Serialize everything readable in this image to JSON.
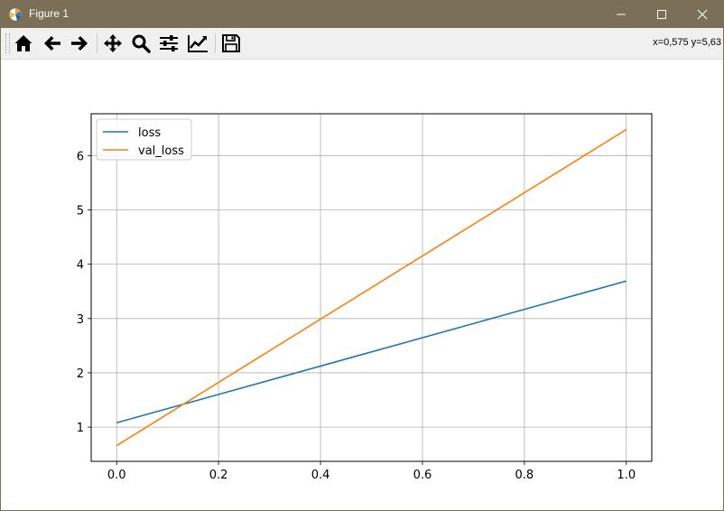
{
  "window": {
    "title": "Figure 1",
    "accent": "#7b6f57"
  },
  "toolbar": {
    "buttons": [
      {
        "name": "home-button",
        "icon": "home-icon"
      },
      {
        "name": "back-button",
        "icon": "arrow-left-icon"
      },
      {
        "name": "forward-button",
        "icon": "arrow-right-icon"
      },
      {
        "name": "pan-button",
        "icon": "move-icon"
      },
      {
        "name": "zoom-button",
        "icon": "magnifier-icon"
      },
      {
        "name": "subplots-button",
        "icon": "sliders-icon"
      },
      {
        "name": "edit-axes-button",
        "icon": "line-chart-icon"
      },
      {
        "name": "save-button",
        "icon": "floppy-disk-icon"
      }
    ],
    "coordinates": "x=0,575 y=5,63"
  },
  "chart_data": {
    "type": "line",
    "x": [
      0.0,
      1.0
    ],
    "series": [
      {
        "name": "loss",
        "values": [
          1.08,
          3.69
        ],
        "color": "#1f77b4"
      },
      {
        "name": "val_loss",
        "values": [
          0.66,
          6.48
        ],
        "color": "#ff7f0e"
      }
    ],
    "xlim": [
      -0.05,
      1.05
    ],
    "ylim": [
      0.37,
      6.77
    ],
    "xticks": [
      0.0,
      0.2,
      0.4,
      0.6,
      0.8,
      1.0
    ],
    "xtick_labels": [
      "0.0",
      "0.2",
      "0.4",
      "0.6",
      "0.8",
      "1.0"
    ],
    "yticks": [
      1,
      2,
      3,
      4,
      5,
      6
    ],
    "ytick_labels": [
      "1",
      "2",
      "3",
      "4",
      "5",
      "6"
    ],
    "grid": true,
    "legend": "upper-left",
    "title": "",
    "xlabel": "",
    "ylabel": ""
  }
}
